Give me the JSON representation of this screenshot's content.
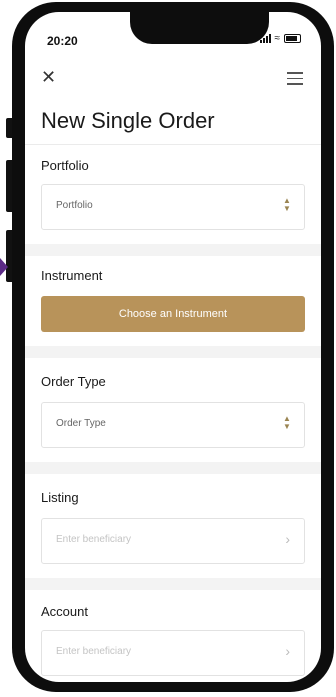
{
  "status_bar": {
    "time": "20:20"
  },
  "header": {
    "title": "New Single Order"
  },
  "sections": {
    "portfolio": {
      "label": "Portfolio",
      "value": "Portfolio"
    },
    "instrument": {
      "label": "Instrument",
      "button_label": "Choose an Instrument"
    },
    "order_type": {
      "label": "Order Type",
      "value": "Order Type"
    },
    "listing": {
      "label": "Listing",
      "placeholder": "Enter beneficiary"
    },
    "account": {
      "label": "Account",
      "placeholder": "Enter beneficiary"
    }
  },
  "icons": {
    "close": "close-icon",
    "menu": "hamburger-menu-icon",
    "select": "updown-chevron-icon",
    "arrow": "chevron-right-icon"
  },
  "colors": {
    "accent": "#b8935a",
    "device": "#0d0d0d",
    "section_gap": "#f3f3f3"
  }
}
